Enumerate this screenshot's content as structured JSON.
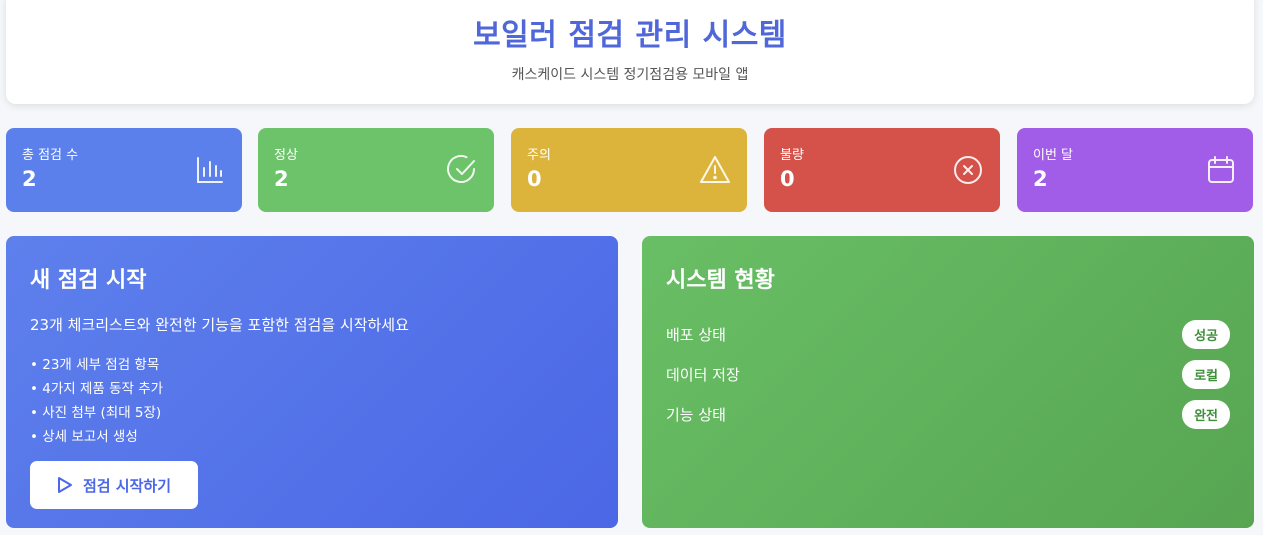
{
  "header": {
    "title": "보일러 점검 관리 시스템",
    "subtitle": "캐스케이드 시스템 정기점검용 모바일 앱"
  },
  "stats": [
    {
      "label": "총 점검 수",
      "value": "2",
      "color": "#5b80ec",
      "icon": "bar-chart-icon"
    },
    {
      "label": "정상",
      "value": "2",
      "color": "#6cc36a",
      "icon": "check-circle-icon"
    },
    {
      "label": "주의",
      "value": "0",
      "color": "#dcb43c",
      "icon": "warning-icon"
    },
    {
      "label": "불량",
      "value": "0",
      "color": "#d4524a",
      "icon": "x-circle-icon"
    },
    {
      "label": "이번 달",
      "value": "2",
      "color": "#a15de8",
      "icon": "calendar-icon"
    }
  ],
  "start_card": {
    "title": "새 점검 시작",
    "description": "23개 체크리스트와 완전한 기능을 포함한 점검을 시작하세요",
    "features": [
      "• 23개 세부 점검 항목",
      "• 4가지 제품 동작 추가",
      "• 사진 첨부 (최대 5장)",
      "• 상세 보고서 생성"
    ],
    "button_label": "점검 시작하기"
  },
  "status_card": {
    "title": "시스템 현황",
    "rows": [
      {
        "name": "배포 상태",
        "badge": "성공"
      },
      {
        "name": "데이터 저장",
        "badge": "로컬"
      },
      {
        "name": "기능 상태",
        "badge": "완전"
      }
    ]
  }
}
